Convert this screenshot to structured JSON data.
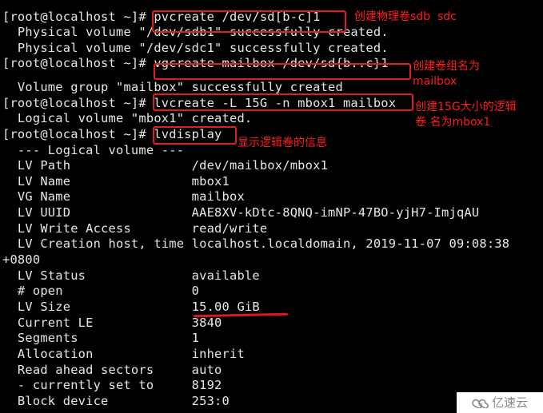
{
  "terminal": {
    "lines": [
      "[root@localhost ~]# pvcreate /dev/sd[b-c]1",
      "  Physical volume \"/dev/sdb1\" successfully created.",
      "  Physical volume \"/dev/sdc1\" successfully created.",
      "[root@localhost ~]# vgcreate mailbox /dev/sd{b..c}1",
      "  Volume group \"mailbox\" successfully created",
      "[root@localhost ~]# lvcreate -L 15G -n mbox1 mailbox",
      "  Logical volume \"mbox1\" created.",
      "[root@localhost ~]# lvdisplay",
      "  --- Logical volume ---",
      "  LV Path                /dev/mailbox/mbox1",
      "  LV Name                mbox1",
      "  VG Name                mailbox",
      "  LV UUID                AAE8XV-kDtc-8QNQ-imNP-47BO-yjH7-ImjqAU",
      "  LV Write Access        read/write",
      "  LV Creation host, time localhost.localdomain, 2019-11-07 09:08:38",
      "+0800",
      "  LV Status              available",
      "  # open                 0",
      "  LV Size                15.00 GiB",
      "  Current LE             3840",
      "  Segments               1",
      "  Allocation             inherit",
      "  Read ahead sectors     auto",
      "  - currently set to     8192",
      "  Block device           253:0"
    ]
  },
  "annotations": {
    "pvcreate": "创建物理卷sdb  sdc",
    "vgcreate": "创建卷组名为\nmailbox",
    "lvcreate": "创建15G大小的逻辑\n卷 名为mbox1",
    "lvdisplay": "显示逻辑卷的信息"
  },
  "watermark": {
    "text": "亿速云",
    "icon": "cloud-logo-icon"
  },
  "colors": {
    "background": "#000000",
    "text": "#e6e6e6",
    "annotation": "#ff1c1c",
    "highlight_box": "#e11d1d"
  }
}
